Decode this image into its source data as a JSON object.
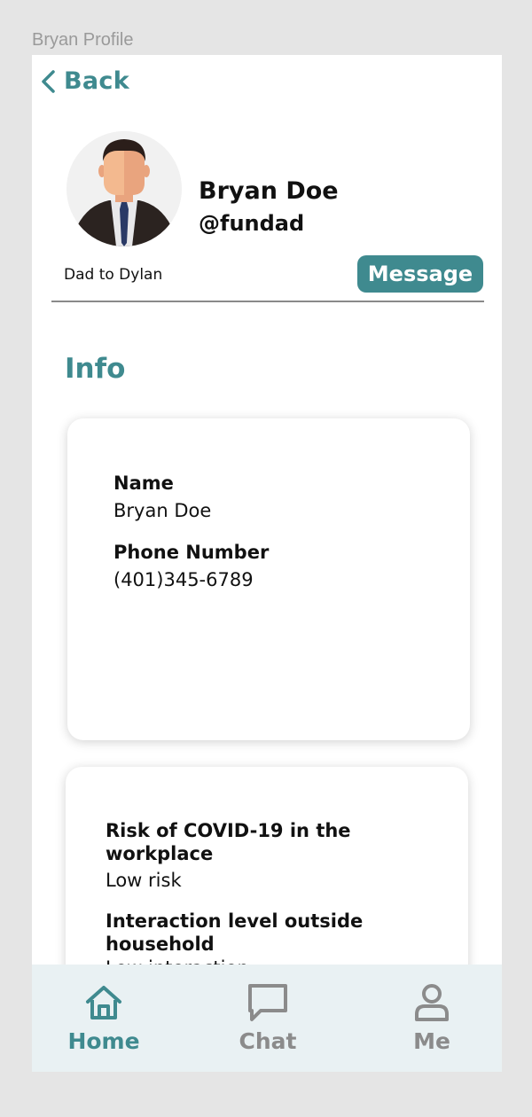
{
  "frame": {
    "title": "Bryan Profile"
  },
  "header": {
    "back_label": "Back"
  },
  "profile": {
    "name": "Bryan Doe",
    "handle": "@fundad",
    "bio": "Dad to Dylan",
    "message_label": "Message"
  },
  "info": {
    "title": "Info",
    "card1": {
      "name_label": "Name",
      "name_value": "Bryan Doe",
      "phone_label": "Phone Number",
      "phone_value": "(401)345-6789"
    },
    "card2": {
      "risk_label_line1": "Risk of COVID-19 in the",
      "risk_label_line2": "workplace",
      "risk_value": "Low risk",
      "interaction_label_line1": "Interaction level outside",
      "interaction_label_line2": "household",
      "interaction_value": "Low interaction"
    }
  },
  "tabbar": {
    "tabs": [
      {
        "label": "Home",
        "icon": "home-icon",
        "active": true
      },
      {
        "label": "Chat",
        "icon": "chat-icon",
        "active": false
      },
      {
        "label": "Me",
        "icon": "person-icon",
        "active": false
      }
    ]
  },
  "colors": {
    "accent": "#3f8a8f",
    "inactive": "#8b8b8b",
    "tabbar_bg": "#e9f1f3"
  }
}
